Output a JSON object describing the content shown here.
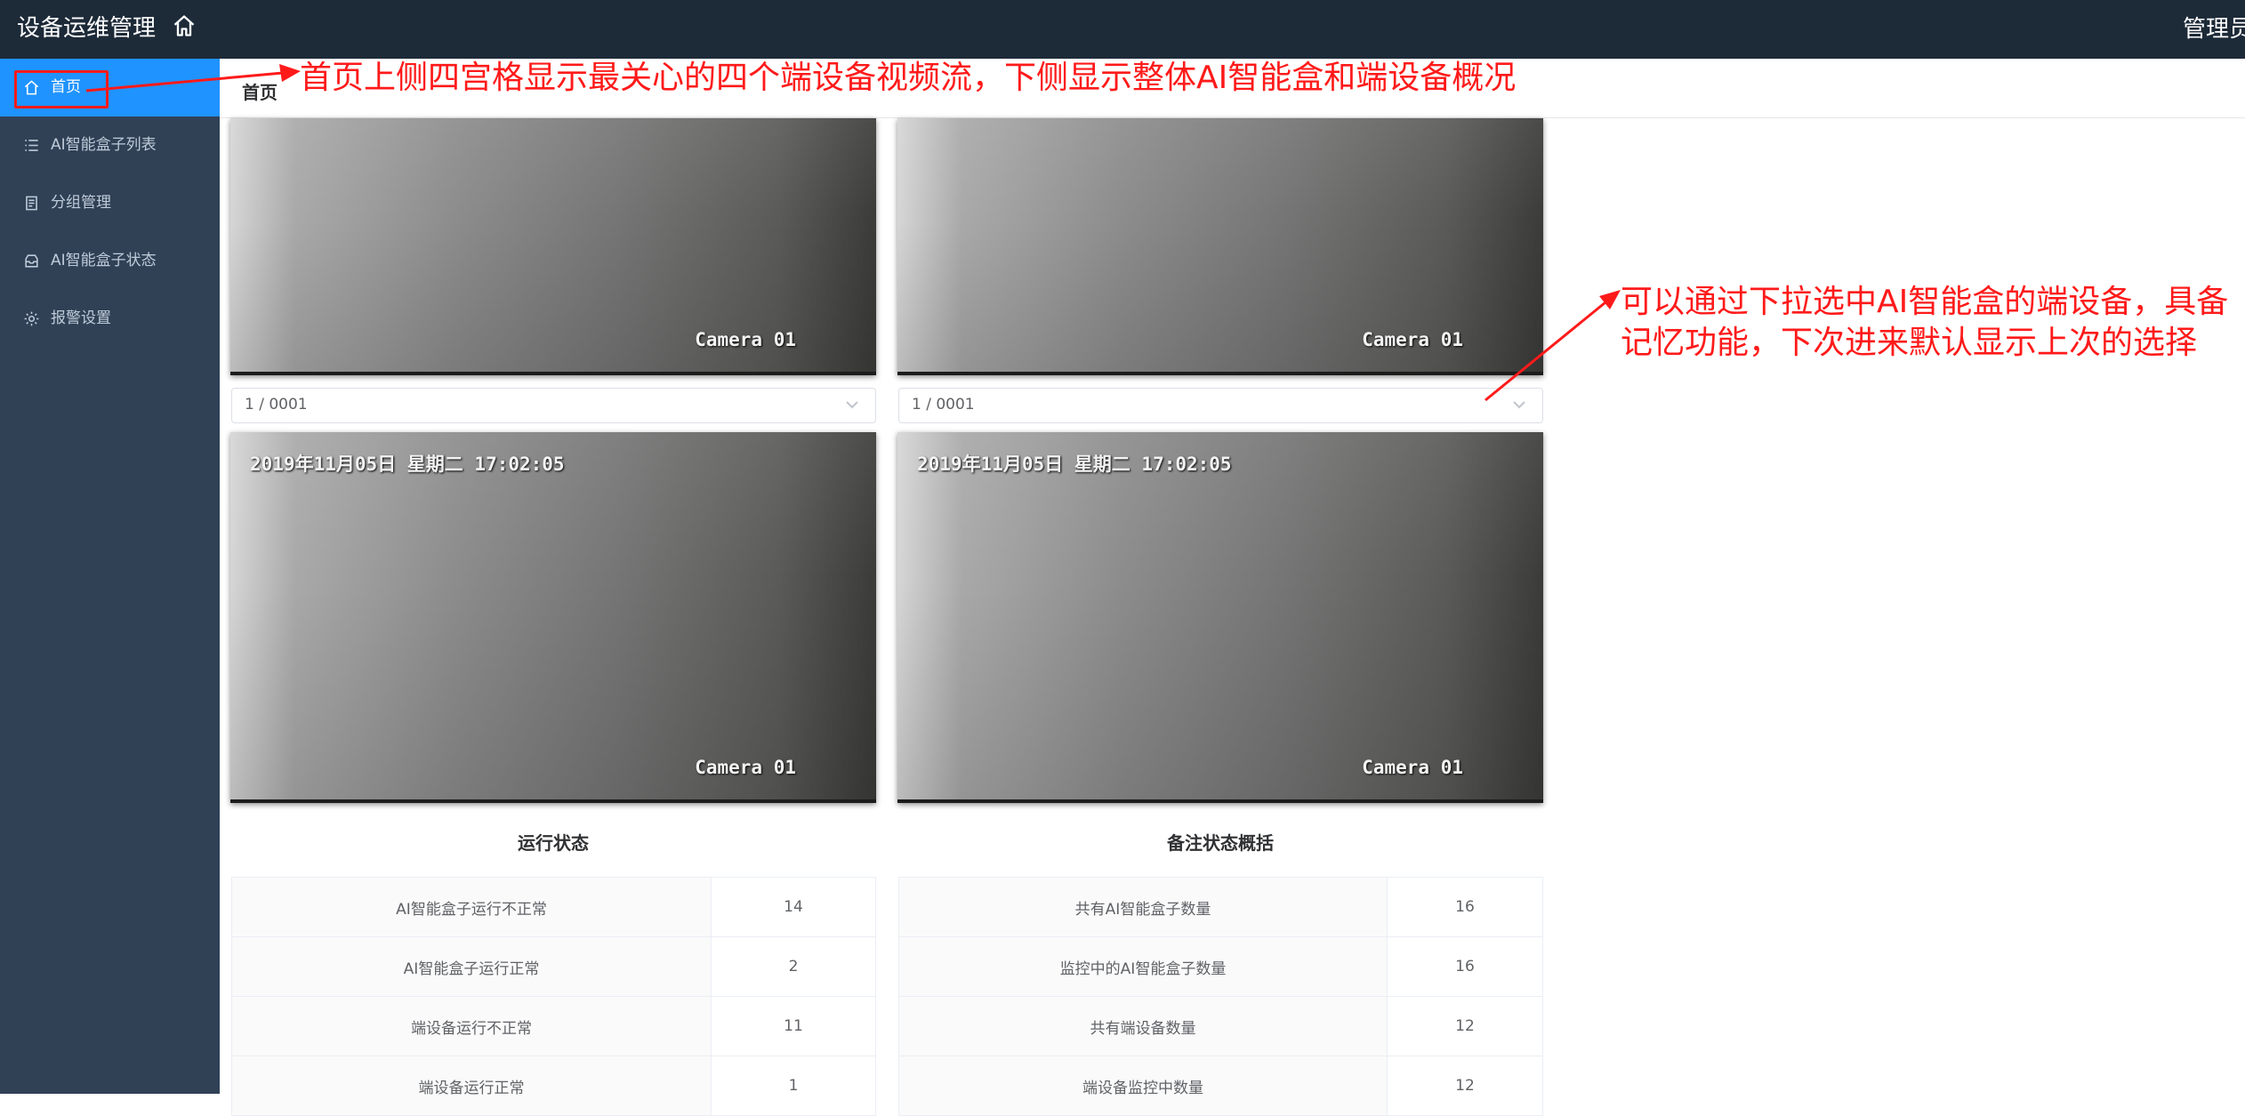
{
  "header": {
    "title": "设备运维管理",
    "user": "管理员",
    "home_icon": "home-icon"
  },
  "sidebar": {
    "items": [
      {
        "label": "首页",
        "icon": "home-icon",
        "active": true
      },
      {
        "label": "AI智能盒子列表",
        "icon": "list-icon",
        "active": false
      },
      {
        "label": "分组管理",
        "icon": "document-icon",
        "active": false
      },
      {
        "label": "AI智能盒子状态",
        "icon": "inbox-icon",
        "active": false
      },
      {
        "label": "报警设置",
        "icon": "gear-icon",
        "active": false
      }
    ]
  },
  "breadcrumb": "首页",
  "videos": {
    "camera_label": "Camera 01",
    "timestamp": "2019年11月05日 星期二 17:02:05"
  },
  "selects": {
    "left_value": "1 / 0001",
    "right_value": "1 / 0001"
  },
  "run_status": {
    "title": "运行状态",
    "rows": [
      {
        "label": "AI智能盒子运行不正常",
        "value": "14"
      },
      {
        "label": "AI智能盒子运行正常",
        "value": "2"
      },
      {
        "label": "端设备运行不正常",
        "value": "11"
      },
      {
        "label": "端设备运行正常",
        "value": "1"
      }
    ]
  },
  "note_status": {
    "title": "备注状态概括",
    "rows": [
      {
        "label": "共有AI智能盒子数量",
        "value": "16"
      },
      {
        "label": "监控中的AI智能盒子数量",
        "value": "16"
      },
      {
        "label": "共有端设备数量",
        "value": "12"
      },
      {
        "label": "端设备监控中数量",
        "value": "12"
      }
    ]
  },
  "annotations": {
    "top": "首页上侧四宫格显示最关心的四个端设备视频流，下侧显示整体AI智能盒和端设备概况",
    "right_line1": "可以通过下拉选中AI智能盒的端设备，具备",
    "right_line2": "记忆功能，下次进来默认显示上次的选择",
    "color": "#ff1a1a"
  },
  "colors": {
    "topbar": "#1d2a38",
    "sidebar": "#304156",
    "active": "#1f93ff"
  }
}
